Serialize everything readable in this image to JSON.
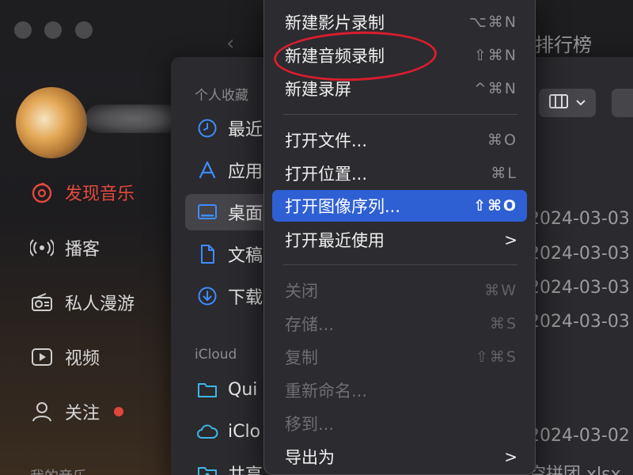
{
  "music_app": {
    "ranking_label": "排行榜",
    "nav": [
      {
        "label": "发现音乐",
        "icon": "netease-music-icon",
        "active": true
      },
      {
        "label": "播客",
        "icon": "podcast-icon"
      },
      {
        "label": "私人漫游",
        "icon": "radio-icon"
      },
      {
        "label": "视频",
        "icon": "video-play-icon"
      },
      {
        "label": "关注",
        "icon": "user-icon",
        "badge": true
      }
    ],
    "section_my_music": "我的音乐"
  },
  "finder": {
    "favorites_header": "个人收藏",
    "favorites": [
      {
        "label": "最近",
        "icon": "clock-icon"
      },
      {
        "label": "应用",
        "icon": "app-store-icon"
      },
      {
        "label": "桌面",
        "icon": "desktop-icon",
        "selected": true
      },
      {
        "label": "文稿",
        "icon": "document-icon"
      },
      {
        "label": "下载",
        "icon": "download-icon"
      }
    ],
    "icloud_header": "iCloud",
    "icloud": [
      {
        "label": "Qui",
        "icon": "folder-icon"
      },
      {
        "label": "iClo",
        "icon": "cloud-icon"
      },
      {
        "label": "共享",
        "icon": "shared-folder-icon"
      }
    ],
    "file_dates": [
      "2024-03-03",
      "2024-03-03",
      "2024-03-03",
      "2024-03-03",
      "2024-03-02"
    ],
    "file_name_partial": "空拼团.xlsx"
  },
  "menu": {
    "items": [
      {
        "label": "新建影片录制",
        "shortcut": "⌥⌘N"
      },
      {
        "label": "新建音频录制",
        "shortcut": "⇧⌘N"
      },
      {
        "label": "新建录屏",
        "shortcut": "^⌘N"
      },
      {
        "label": "打开文件...",
        "shortcut": "⌘O"
      },
      {
        "label": "打开位置...",
        "shortcut": "⌘L"
      },
      {
        "label": "打开图像序列...",
        "shortcut": "⇧⌘O",
        "highlighted": true
      },
      {
        "label": "打开最近使用",
        "submenu": true
      },
      {
        "label": "关闭",
        "shortcut": "⌘W",
        "disabled": true
      },
      {
        "label": "存储...",
        "shortcut": "⌘S",
        "disabled": true
      },
      {
        "label": "复制",
        "shortcut": "⇧⌘S",
        "disabled": true
      },
      {
        "label": "重新命名...",
        "disabled": true
      },
      {
        "label": "移到...",
        "disabled": true
      },
      {
        "label": "导出为",
        "submenu": true
      }
    ],
    "submenu_glyph": ">",
    "annotation_color": "#d81e2d"
  },
  "colors": {
    "accent_highlight": "#2e5fd3",
    "music_active": "#e34a3d"
  }
}
